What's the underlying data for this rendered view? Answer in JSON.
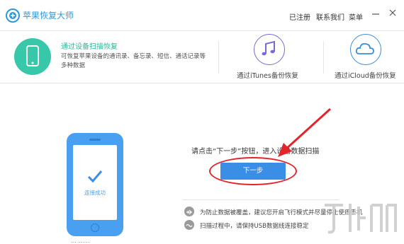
{
  "app": {
    "title": "苹果恢复大师"
  },
  "header": {
    "links": {
      "registered": "已注册",
      "contact": "联系我们",
      "menu": "菜单"
    }
  },
  "modes": {
    "device": {
      "title": "通过设备扫描恢复",
      "desc": "可恢复苹果设备的通讯录、备忘录、短信、通话记录等多种数据"
    },
    "itunes": {
      "label": "通过iTunes备份恢复"
    },
    "icloud": {
      "label": "通过iCloud备份恢复"
    }
  },
  "main": {
    "phone_status": "连接成功",
    "below_phone_text": "… ……",
    "instruction": "请点击“下一步”按钮，进入设备数据扫描",
    "next_button": "下一步",
    "tips": [
      "为防止数据被覆盖，建议您开启飞行模式并尽量停止使用手机",
      "扫描过程中，请保持USB数据线连接稳定"
    ]
  },
  "colors": {
    "brand": "#2b9bd8",
    "device_green": "#36c8a8",
    "phone_blue": "#4aa0f0",
    "button_blue": "#3a8ee6",
    "annotation_red": "#e2252b",
    "itunes_purple": "#7b68d6"
  },
  "icons": [
    "app-logo-icon",
    "minimize-icon",
    "close-icon",
    "phone-icon",
    "music-note-icon",
    "cloud-icon",
    "checkmark-icon",
    "airplane-icon",
    "usb-icon",
    "watermark-logo"
  ]
}
